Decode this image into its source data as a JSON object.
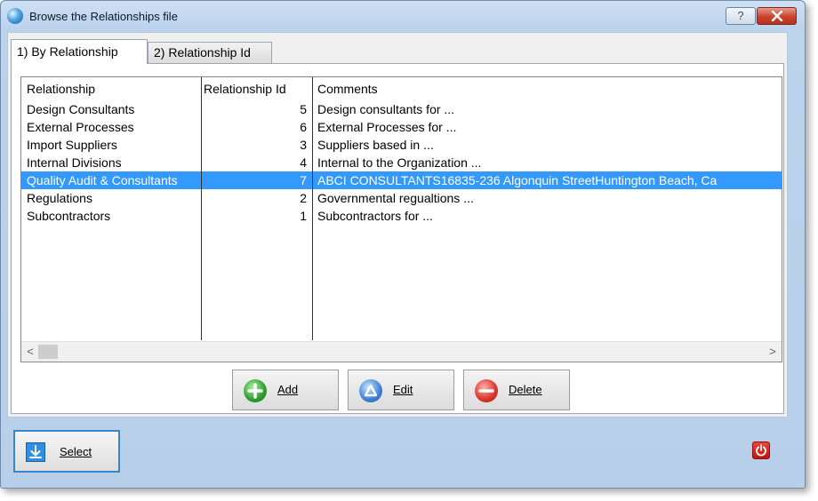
{
  "window": {
    "title": "Browse the Relationships file",
    "help_label": "?"
  },
  "tabs": [
    {
      "label": "1) By Relationship",
      "active": true
    },
    {
      "label": "2) Relationship Id",
      "active": false
    }
  ],
  "grid": {
    "columns": [
      "Relationship",
      "Relationship Id",
      "Comments"
    ],
    "rows": [
      {
        "relationship": "Design Consultants",
        "id": "5",
        "comments": "Design consultants for ..."
      },
      {
        "relationship": "External Processes",
        "id": "6",
        "comments": "External Processes for ..."
      },
      {
        "relationship": "Import Suppliers",
        "id": "3",
        "comments": "Suppliers based in ..."
      },
      {
        "relationship": "Internal Divisions",
        "id": "4",
        "comments": "Internal to the Organization ..."
      },
      {
        "relationship": "Quality Audit & Consultants",
        "id": "7",
        "comments": "ABCI CONSULTANTS16835-236 Algonquin StreetHuntington Beach, Ca",
        "selected": true
      },
      {
        "relationship": "Regulations",
        "id": "2",
        "comments": "Governmental regualtions ..."
      },
      {
        "relationship": "Subcontractors",
        "id": "1",
        "comments": "Subcontractors for ..."
      }
    ],
    "scroll_left": "<",
    "scroll_right": ">"
  },
  "actions": {
    "add_label": "Add",
    "edit_label": "Edit",
    "delete_label": "Delete"
  },
  "footer": {
    "select_label": "Select"
  },
  "colors": {
    "selection": "#3399ff",
    "accent": "#3a86c8"
  }
}
